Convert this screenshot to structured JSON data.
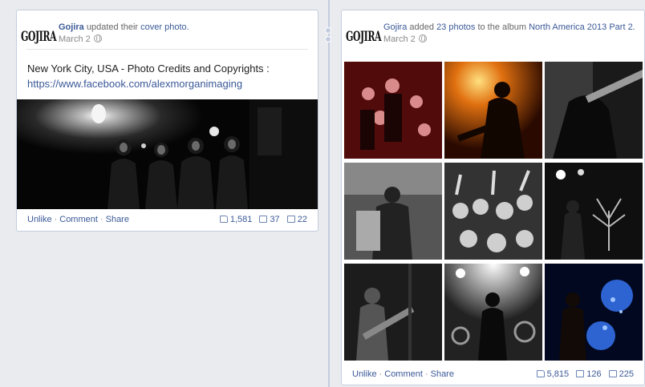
{
  "left_post": {
    "page_name": "Gojira",
    "action_text": "updated their",
    "action_link": "cover photo.",
    "date": "March 2",
    "message_line1": "New York City, USA - Photo Credits and Copyrights :",
    "message_link": "https://www.facebook.com/alexmorganimaging",
    "actions": {
      "unlike": "Unlike",
      "comment": "Comment",
      "share": "Share",
      "separator": "·"
    },
    "stats": {
      "likes": "1,581",
      "comments": "37",
      "shares": "22"
    }
  },
  "right_post": {
    "page_name": "Gojira",
    "action_text": "added",
    "photo_count_link": "23 photos",
    "to_text": "to the album",
    "album_link": "North America 2013 Part 2.",
    "date": "March 2",
    "actions": {
      "unlike": "Unlike",
      "comment": "Comment",
      "share": "Share",
      "separator": "·"
    },
    "stats": {
      "likes": "5,815",
      "comments": "126",
      "shares": "225"
    }
  },
  "logo_text": "GOJIRA",
  "colors": {
    "link": "#3b5998",
    "background": "#e9ebee",
    "border": "#c4cde0"
  },
  "icons": [
    "globe-icon",
    "like-icon",
    "comment-icon",
    "share-icon"
  ]
}
